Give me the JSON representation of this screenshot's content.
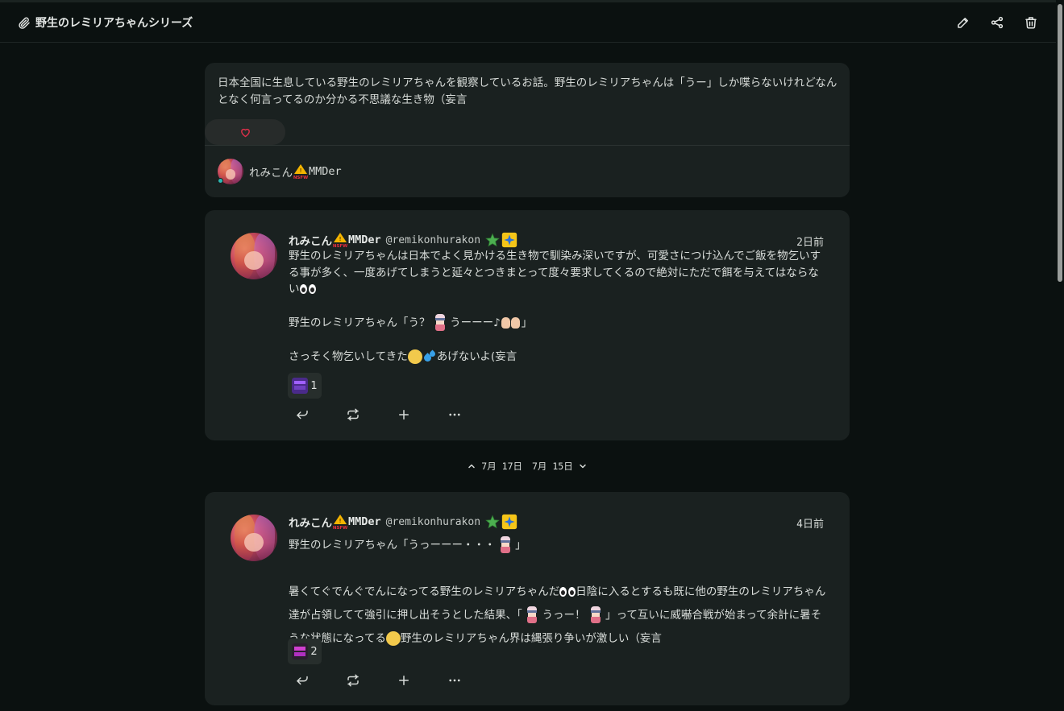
{
  "header": {
    "title": "野生のレミリアちゃんシリーズ",
    "clip_icon": "paperclip-icon",
    "actions": [
      "edit-icon",
      "share-icon",
      "trash-icon"
    ]
  },
  "description": {
    "text": "日本全国に生息している野生のレミリアちゃんを観察しているお話。野生のレミリアちゃんは「うー」しか喋らないけれどなんとなく何言ってるのか分かる不思議な生き物（妄言",
    "owner_name": "れみこん",
    "owner_suffix": "MMDer",
    "colors": {
      "like": "#e0304a",
      "online": "#2bb9b3"
    }
  },
  "notes": [
    {
      "name": "れみこん",
      "name_suffix": "MMDer",
      "handle": "@remikonhurakon",
      "time": "2日前",
      "body": {
        "p1": "野生のレミリアちゃんは日本でよく見かける生き物で馴染み深いですが、可愛さにつけ込んでご飯を物乞いする事が多く、一度あげてしまうと延々とつきまとって度々要求してくるので絶対にただで餌を与えてはならない",
        "p2a": "野生のレミリアちゃん「う？",
        "p2b": "うーーー♪",
        "p2c": "」",
        "p3a": "さっそく物乞いしてきた",
        "p3b": "あげないよ(妄言"
      },
      "reaction_count": "1"
    },
    {
      "name": "れみこん",
      "name_suffix": "MMDer",
      "handle": "@remikonhurakon",
      "time": "4日前",
      "body": {
        "p1a": "野生のレミリアちゃん「うっーーー・・・",
        "p1b": "」",
        "p2a": "暑くてぐでんぐでんになってる野生のレミリアちゃんだ",
        "p2b": "日陰に入るとするも既に他の野生のレミリアちゃん達が占領してて強引に押し出そうとした結果、「",
        "p2c": "うっー！",
        "p2d": "」って互いに威嚇合戦が始まって余計に暑そうな状態になってる",
        "p2e": "野生のレミリアちゃん界は縄張り争いが激しい（妄言"
      },
      "reaction_count": "2"
    }
  ],
  "date_separator": {
    "prev": "7月 17日",
    "next": "7月 15日"
  },
  "footer_icons": [
    "reply-icon",
    "renote-icon",
    "plus-icon",
    "more-icon"
  ]
}
